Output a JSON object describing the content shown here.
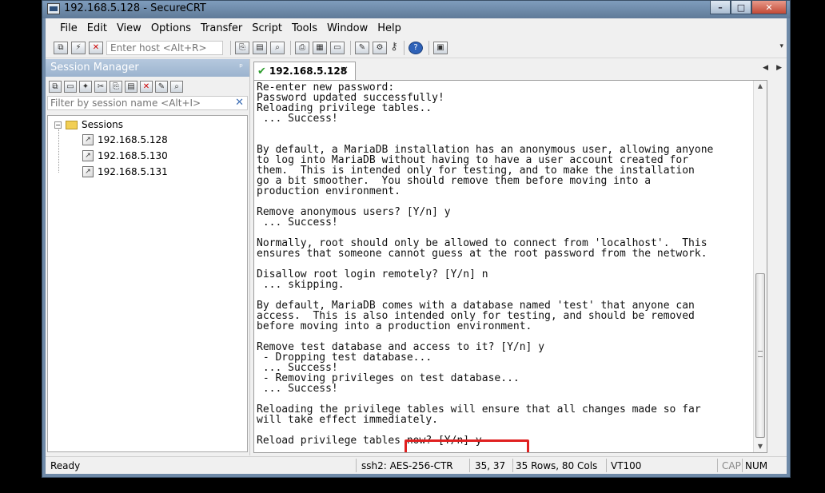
{
  "window": {
    "title": "192.168.5.128 - SecureCRT",
    "minimize_label": "–",
    "maximize_label": "□",
    "close_label": "✕"
  },
  "menu": [
    "File",
    "Edit",
    "View",
    "Options",
    "Transfer",
    "Script",
    "Tools",
    "Window",
    "Help"
  ],
  "toolbar": {
    "host_placeholder": "Enter host <Alt+R>"
  },
  "session_manager": {
    "title": "Session Manager",
    "pin_label": "ᵖ",
    "filter_placeholder": "Filter by session name <Alt+I>",
    "clear_label": "✕",
    "folder_label": "Sessions",
    "expander_label": "−",
    "sessions": [
      "192.168.5.128",
      "192.168.5.130",
      "192.168.5.131"
    ]
  },
  "tab": {
    "label": "192.168.5.128",
    "check": "✔",
    "close": "✕"
  },
  "terminal": {
    "lines": [
      "Re-enter new password:",
      "Password updated successfully!",
      "Reloading privilege tables..",
      " ... Success!",
      "",
      "",
      "By default, a MariaDB installation has an anonymous user, allowing anyone",
      "to log into MariaDB without having to have a user account created for",
      "them.  This is intended only for testing, and to make the installation",
      "go a bit smoother.  You should remove them before moving into a",
      "production environment.",
      "",
      "Remove anonymous users? [Y/n] y",
      " ... Success!",
      "",
      "Normally, root should only be allowed to connect from 'localhost'.  This",
      "ensures that someone cannot guess at the root password from the network.",
      "",
      "Disallow root login remotely? [Y/n] n",
      " ... skipping.",
      "",
      "By default, MariaDB comes with a database named 'test' that anyone can",
      "access.  This is also intended only for testing, and should be removed",
      "before moving into a production environment.",
      "",
      "Remove test database and access to it? [Y/n] y",
      " - Dropping test database...",
      " ... Success!",
      " - Removing privileges on test database...",
      " ... Success!",
      "",
      "Reloading the privilege tables will ensure that all changes made so far",
      "will take effect immediately.",
      "",
      "Reload privilege tables now? [Y/n] y"
    ]
  },
  "status": {
    "ready": "Ready",
    "cipher": "ssh2: AES-256-CTR",
    "cursor": "35,  37",
    "size": "35 Rows, 80 Cols",
    "emulation": "VT100",
    "cap": "CAP",
    "num": "NUM"
  }
}
